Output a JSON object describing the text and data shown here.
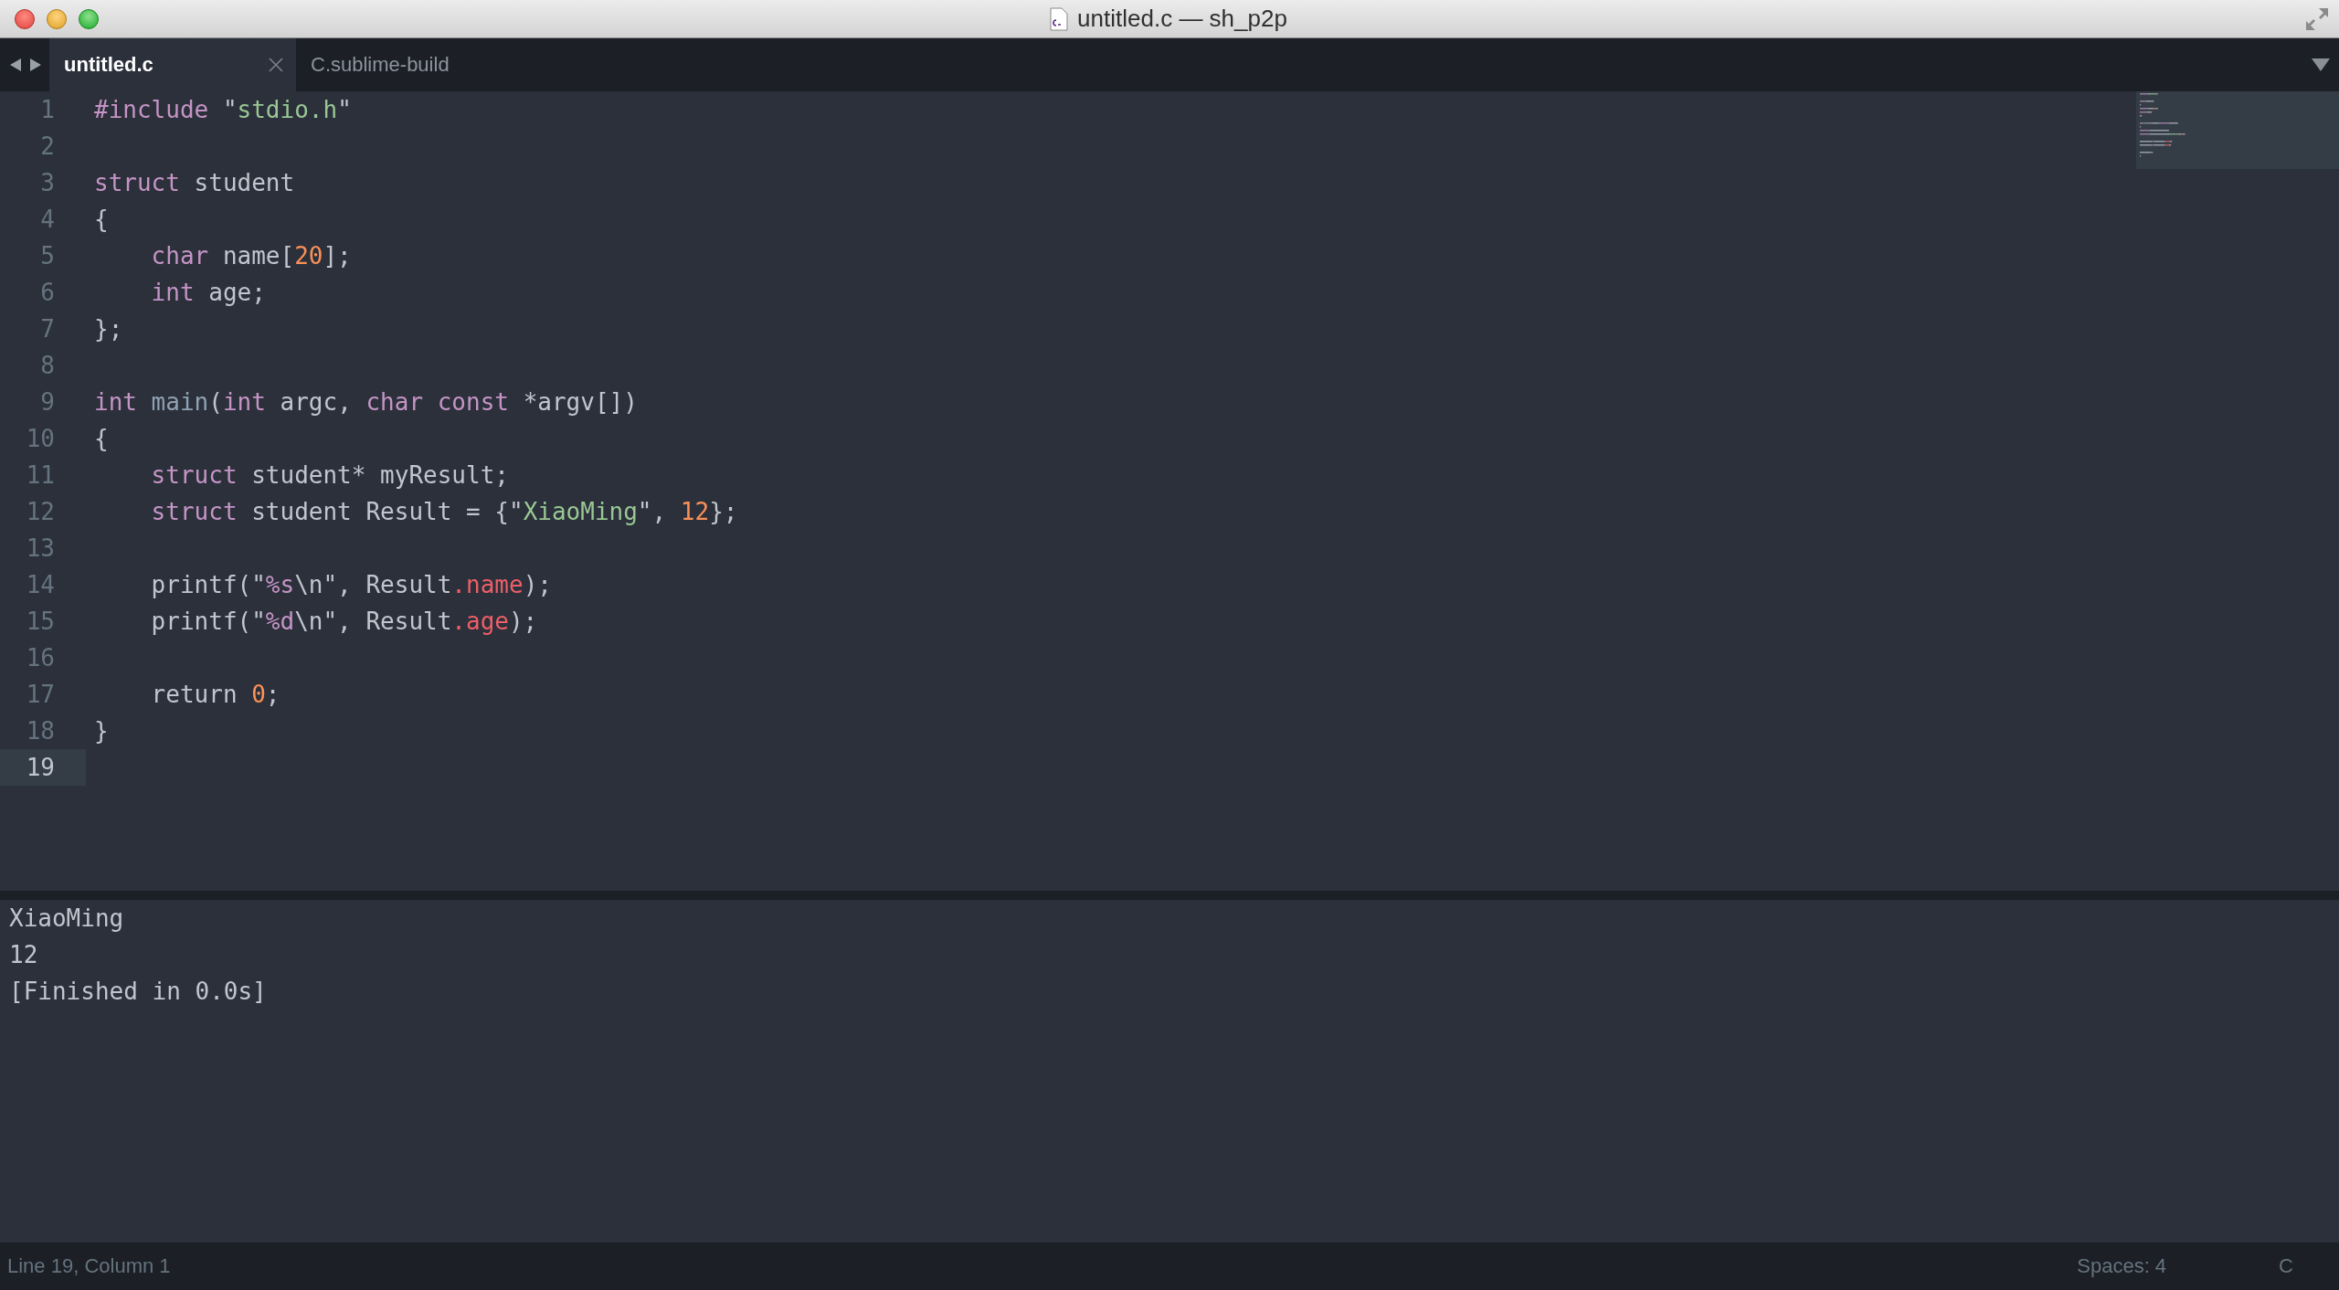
{
  "window": {
    "title": "untitled.c — sh_p2p"
  },
  "tabs": [
    {
      "label": "untitled.c",
      "selected": true
    },
    {
      "label": "C.sublime-build",
      "selected": false
    }
  ],
  "editor": {
    "lines": [
      {
        "number": "1",
        "current": false,
        "tokens": [
          {
            "text": "#include",
            "kind": "keyword"
          },
          {
            "text": " \"",
            "kind": "plain"
          },
          {
            "text": "stdio.h",
            "kind": "string"
          },
          {
            "text": "\"",
            "kind": "plain"
          }
        ]
      },
      {
        "number": "2",
        "current": false
      },
      {
        "number": "3",
        "current": false,
        "tokens": [
          {
            "text": "struct",
            "kind": "keyword"
          },
          {
            "text": " student",
            "kind": "plain"
          }
        ]
      },
      {
        "number": "4",
        "current": false,
        "tokens": [
          {
            "text": "{",
            "kind": "plain"
          }
        ]
      },
      {
        "number": "5",
        "current": false,
        "tokens": [
          {
            "text": "    char",
            "kind": "keyword"
          },
          {
            "text": " name[",
            "kind": "plain"
          },
          {
            "text": "20",
            "kind": "number"
          },
          {
            "text": "];",
            "kind": "plain"
          }
        ]
      },
      {
        "number": "6",
        "current": false,
        "tokens": [
          {
            "text": "    int",
            "kind": "keyword"
          },
          {
            "text": " age;",
            "kind": "plain"
          }
        ]
      },
      {
        "number": "7",
        "current": false,
        "tokens": [
          {
            "text": "};",
            "kind": "plain"
          }
        ]
      },
      {
        "number": "8",
        "current": false
      },
      {
        "number": "9",
        "current": false,
        "tokens": [
          {
            "text": "int",
            "kind": "keyword"
          },
          {
            "text": " main",
            "kind": "function"
          },
          {
            "text": "(",
            "kind": "plain"
          },
          {
            "text": "int",
            "kind": "keyword"
          },
          {
            "text": " argc, ",
            "kind": "plain"
          },
          {
            "text": "char const",
            "kind": "keyword"
          },
          {
            "text": " *argv[])",
            "kind": "plain"
          }
        ]
      },
      {
        "number": "10",
        "current": false,
        "tokens": [
          {
            "text": "{",
            "kind": "plain"
          }
        ]
      },
      {
        "number": "11",
        "current": false,
        "tokens": [
          {
            "text": "    struct",
            "kind": "keyword"
          },
          {
            "text": " student* myResult;",
            "kind": "plain"
          }
        ]
      },
      {
        "number": "12",
        "current": false,
        "tokens": [
          {
            "text": "    struct",
            "kind": "keyword"
          },
          {
            "text": " student Result = {\"",
            "kind": "plain"
          },
          {
            "text": "XiaoMing",
            "kind": "string"
          },
          {
            "text": "\", ",
            "kind": "plain"
          },
          {
            "text": "12",
            "kind": "number"
          },
          {
            "text": "};",
            "kind": "plain"
          }
        ]
      },
      {
        "number": "13",
        "current": false
      },
      {
        "number": "14",
        "current": false,
        "tokens": [
          {
            "text": "    printf(\"",
            "kind": "plain"
          },
          {
            "text": "%s",
            "kind": "format"
          },
          {
            "text": "\\n\", Result",
            "kind": "plain"
          },
          {
            "text": ".name",
            "kind": "member"
          },
          {
            "text": ");",
            "kind": "plain"
          }
        ]
      },
      {
        "number": "15",
        "current": false,
        "tokens": [
          {
            "text": "    printf(\"",
            "kind": "plain"
          },
          {
            "text": "%d",
            "kind": "format"
          },
          {
            "text": "\\n\", Result",
            "kind": "plain"
          },
          {
            "text": ".age",
            "kind": "member"
          },
          {
            "text": ");",
            "kind": "plain"
          }
        ]
      },
      {
        "number": "16",
        "current": false
      },
      {
        "number": "17",
        "current": false,
        "tokens": [
          {
            "text": "    return ",
            "kind": "plain"
          },
          {
            "text": "0",
            "kind": "number"
          },
          {
            "text": ";",
            "kind": "plain"
          }
        ]
      },
      {
        "number": "18",
        "current": false,
        "tokens": [
          {
            "text": "}",
            "kind": "plain"
          }
        ]
      },
      {
        "number": "19",
        "current": true
      }
    ]
  },
  "output": {
    "lines": [
      "XiaoMing",
      "12",
      "[Finished in 0.0s]"
    ]
  },
  "status_bar": {
    "position": "Line 19, Column 1",
    "indentation": "Spaces: 4",
    "syntax": "C"
  }
}
